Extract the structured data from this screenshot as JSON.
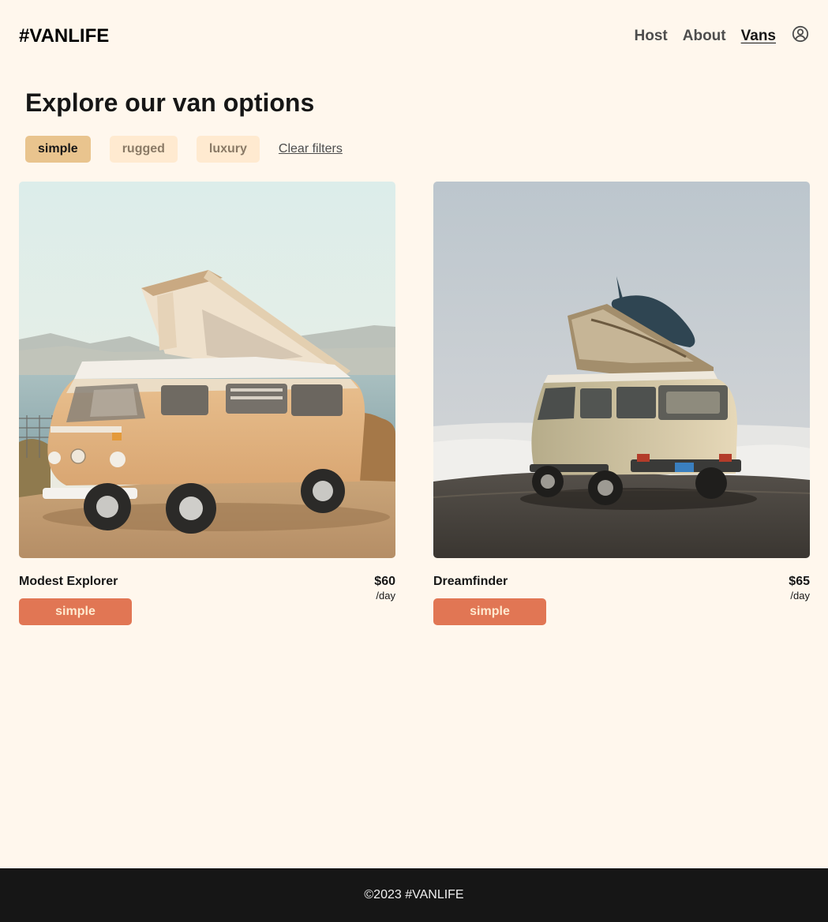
{
  "header": {
    "logo": "#VANLIFE",
    "nav": [
      {
        "label": "Host",
        "active": false
      },
      {
        "label": "About",
        "active": false
      },
      {
        "label": "Vans",
        "active": true
      }
    ],
    "account_icon": "user-circle-icon"
  },
  "main": {
    "title": "Explore our van options",
    "filters": [
      {
        "label": "simple",
        "selected": true
      },
      {
        "label": "rugged",
        "selected": false
      },
      {
        "label": "luxury",
        "selected": false
      }
    ],
    "clear_filters": "Clear filters",
    "vans": [
      {
        "name": "Modest Explorer",
        "price": "$60",
        "unit": "/day",
        "type": "simple",
        "image_subject": "van-photo-modest-explorer"
      },
      {
        "name": "Dreamfinder",
        "price": "$65",
        "unit": "/day",
        "type": "simple",
        "image_subject": "van-photo-dreamfinder"
      }
    ]
  },
  "footer": {
    "text": "©2023 #VANLIFE"
  },
  "colors": {
    "background": "#FFF7ED",
    "filter_selected": "#E9C48E",
    "filter_unselected": "#FFEAD0",
    "badge_simple": "#E17654",
    "footer_bg": "#161616"
  }
}
